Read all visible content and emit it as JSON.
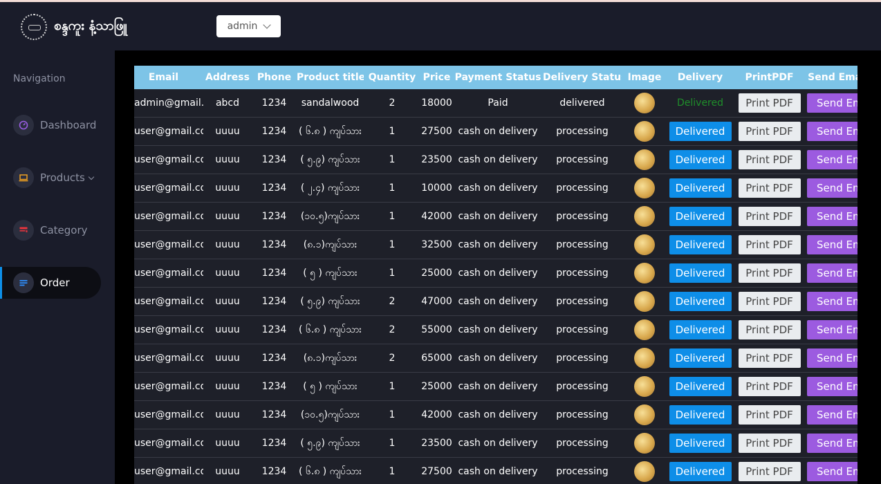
{
  "header": {
    "logo_text": "စန္ဒကူး နံ့သာဖြူ",
    "user_menu": "admin"
  },
  "sidebar": {
    "title": "Navigation",
    "items": [
      {
        "label": "Dashboard"
      },
      {
        "label": "Products"
      },
      {
        "label": "Category"
      },
      {
        "label": "Order"
      }
    ]
  },
  "colors": {
    "accent": "#0e8ee8",
    "table_header": "#7dc4e7",
    "send_email": "#9c5be0",
    "delivered_text": "#1f8f2a"
  },
  "table": {
    "headers": [
      "Email",
      "Address",
      "Phone",
      "Product title",
      "Quantity",
      "Price",
      "Payment Status",
      "Delivery Status",
      "Image",
      "Delivery",
      "PrintPDF",
      "Send Email"
    ],
    "print_label": "Print PDF",
    "send_label": "Send Email",
    "delivered_label": "Delivered",
    "rows": [
      {
        "email": "admin@gmail.com",
        "address": "abcd",
        "phone": "1234",
        "product": "sandalwood",
        "qty": "2",
        "price": "18000",
        "payment": "Paid",
        "delivery": "delivered",
        "delivered": true
      },
      {
        "email": "user@gmail.com",
        "address": "uuuu",
        "phone": "1234",
        "product": "( ၆.၈ ) ကျပ်သား",
        "qty": "1",
        "price": "27500",
        "payment": "cash on delivery",
        "delivery": "processing",
        "delivered": false
      },
      {
        "email": "user@gmail.com",
        "address": "uuuu",
        "phone": "1234",
        "product": "( ၅.၉) ကျပ်သား",
        "qty": "1",
        "price": "23500",
        "payment": "cash on delivery",
        "delivery": "processing",
        "delivered": false
      },
      {
        "email": "user@gmail.com",
        "address": "uuuu",
        "phone": "1234",
        "product": "( ၂.၄) ကျပ်သား",
        "qty": "1",
        "price": "10000",
        "payment": "cash on delivery",
        "delivery": "processing",
        "delivered": false
      },
      {
        "email": "user@gmail.com",
        "address": "uuuu",
        "phone": "1234",
        "product": "(၁၀.၅)ကျပ်သား",
        "qty": "1",
        "price": "42000",
        "payment": "cash on delivery",
        "delivery": "processing",
        "delivered": false
      },
      {
        "email": "user@gmail.com",
        "address": "uuuu",
        "phone": "1234",
        "product": "(၈.၁)ကျပ်သား",
        "qty": "1",
        "price": "32500",
        "payment": "cash on delivery",
        "delivery": "processing",
        "delivered": false
      },
      {
        "email": "user@gmail.com",
        "address": "uuuu",
        "phone": "1234",
        "product": "( ၅ ) ကျပ်သား",
        "qty": "1",
        "price": "25000",
        "payment": "cash on delivery",
        "delivery": "processing",
        "delivered": false
      },
      {
        "email": "user@gmail.com",
        "address": "uuuu",
        "phone": "1234",
        "product": "( ၅.၉) ကျပ်သား",
        "qty": "2",
        "price": "47000",
        "payment": "cash on delivery",
        "delivery": "processing",
        "delivered": false
      },
      {
        "email": "user@gmail.com",
        "address": "uuuu",
        "phone": "1234",
        "product": "( ၆.၈ ) ကျပ်သား",
        "qty": "2",
        "price": "55000",
        "payment": "cash on delivery",
        "delivery": "processing",
        "delivered": false
      },
      {
        "email": "user@gmail.com",
        "address": "uuuu",
        "phone": "1234",
        "product": "(၈.၁)ကျပ်သား",
        "qty": "2",
        "price": "65000",
        "payment": "cash on delivery",
        "delivery": "processing",
        "delivered": false
      },
      {
        "email": "user@gmail.com",
        "address": "uuuu",
        "phone": "1234",
        "product": "( ၅ ) ကျပ်သား",
        "qty": "1",
        "price": "25000",
        "payment": "cash on delivery",
        "delivery": "processing",
        "delivered": false
      },
      {
        "email": "user@gmail.com",
        "address": "uuuu",
        "phone": "1234",
        "product": "(၁၀.၅)ကျပ်သား",
        "qty": "1",
        "price": "42000",
        "payment": "cash on delivery",
        "delivery": "processing",
        "delivered": false
      },
      {
        "email": "user@gmail.com",
        "address": "uuuu",
        "phone": "1234",
        "product": "( ၅.၉) ကျပ်သား",
        "qty": "1",
        "price": "23500",
        "payment": "cash on delivery",
        "delivery": "processing",
        "delivered": false
      },
      {
        "email": "user@gmail.com",
        "address": "uuuu",
        "phone": "1234",
        "product": "( ၆.၈ ) ကျပ်သား",
        "qty": "1",
        "price": "27500",
        "payment": "cash on delivery",
        "delivery": "processing",
        "delivered": false
      }
    ]
  }
}
